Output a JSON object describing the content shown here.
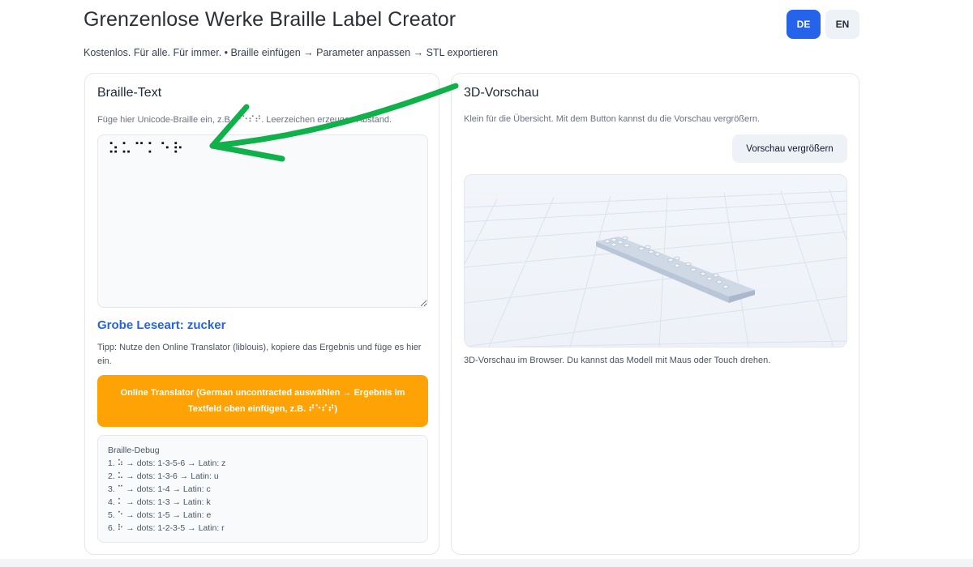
{
  "header": {
    "title": "Grenzenlose Werke Braille Label Creator",
    "subtitle": "Kostenlos. Für alle. Für immer. • Braille einfügen → Parameter anpassen → STL exportieren",
    "lang_de": "DE",
    "lang_en": "EN",
    "active_lang": "DE",
    "accent_color": "#2563eb"
  },
  "braille_panel": {
    "title": "Braille-Text",
    "hint": "Füge hier Unicode-Braille ein, z.B. ⠞⠑⠎⠞. Leerzeichen erzeugen Abstand.",
    "input_value": "⠵⠥⠉⠅⠑⠗",
    "reading_label": "Grobe Leseart:",
    "reading_value": "zucker",
    "tip": "Tipp: Nutze den Online Translator (liblouis), kopiere das Ergebnis und füge es hier ein.",
    "translator_button": "Online Translator (German uncontracted auswählen → Ergebnis im Textfeld oben einfügen, z.B. ⠞⠑⠎⠞)",
    "translator_color": "#ffa206",
    "debug": {
      "title": "Braille-Debug",
      "lines": [
        "1. ⠵  → dots: 1-3-5-6  → Latin: z",
        "2. ⠥  → dots: 1-3-6  → Latin: u",
        "3. ⠉  → dots: 1-4  → Latin: c",
        "4. ⠅  → dots: 1-3  → Latin: k",
        "5. ⠑  → dots: 1-5  → Latin: e",
        "6. ⠗  → dots: 1-2-3-5  → Latin: r"
      ]
    }
  },
  "preview_panel": {
    "title": "3D-Vorschau",
    "hint": "Klein für die Übersicht. Mit dem Button kannst du die Vorschau vergrößern.",
    "zoom_button": "Vorschau vergrößern",
    "caption": "3D-Vorschau im Browser. Du kannst das Modell mit Maus oder Touch drehen."
  },
  "annotation": {
    "arrow_color": "#10b04a"
  }
}
